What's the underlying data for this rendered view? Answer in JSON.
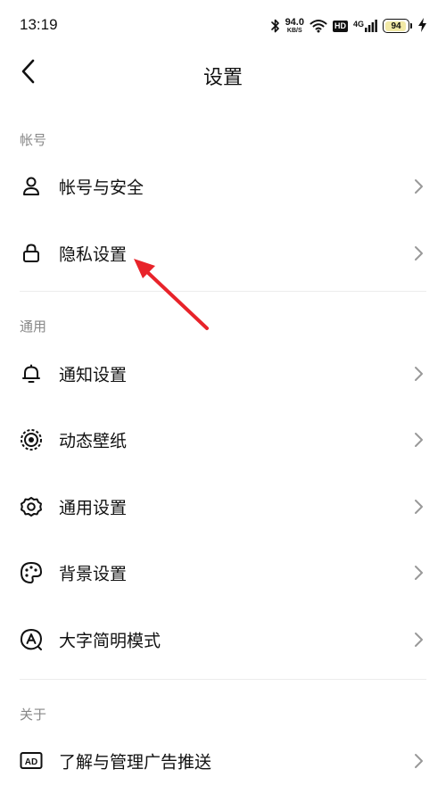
{
  "status_bar": {
    "time": "13:19",
    "net_speed_value": "94.0",
    "net_speed_unit": "KB/S",
    "hd_label": "HD",
    "net_type": "4G",
    "battery_level": "94",
    "battery_fill_fraction": 0.94,
    "icons": [
      "bluetooth-icon",
      "wifi-icon",
      "signal-icon",
      "battery-icon",
      "charging-icon"
    ]
  },
  "header": {
    "title": "设置",
    "back_icon": "chevron-left-icon"
  },
  "sections": [
    {
      "label": "帐号",
      "items": [
        {
          "label": "帐号与安全",
          "icon": "user-icon"
        },
        {
          "label": "隐私设置",
          "icon": "lock-icon"
        }
      ]
    },
    {
      "label": "通用",
      "items": [
        {
          "label": "通知设置",
          "icon": "bell-icon"
        },
        {
          "label": "动态壁纸",
          "icon": "live-wallpaper-icon"
        },
        {
          "label": "通用设置",
          "icon": "gear-icon"
        },
        {
          "label": "背景设置",
          "icon": "palette-icon"
        },
        {
          "label": "大字简明模式",
          "icon": "large-font-icon"
        }
      ]
    },
    {
      "label": "关于",
      "items": [
        {
          "label": "了解与管理广告推送",
          "icon": "ad-icon"
        }
      ]
    }
  ],
  "colors": {
    "annotation_arrow": "#e8232a",
    "section_label": "#888888",
    "chevron": "#999999",
    "divider": "#ececec"
  }
}
